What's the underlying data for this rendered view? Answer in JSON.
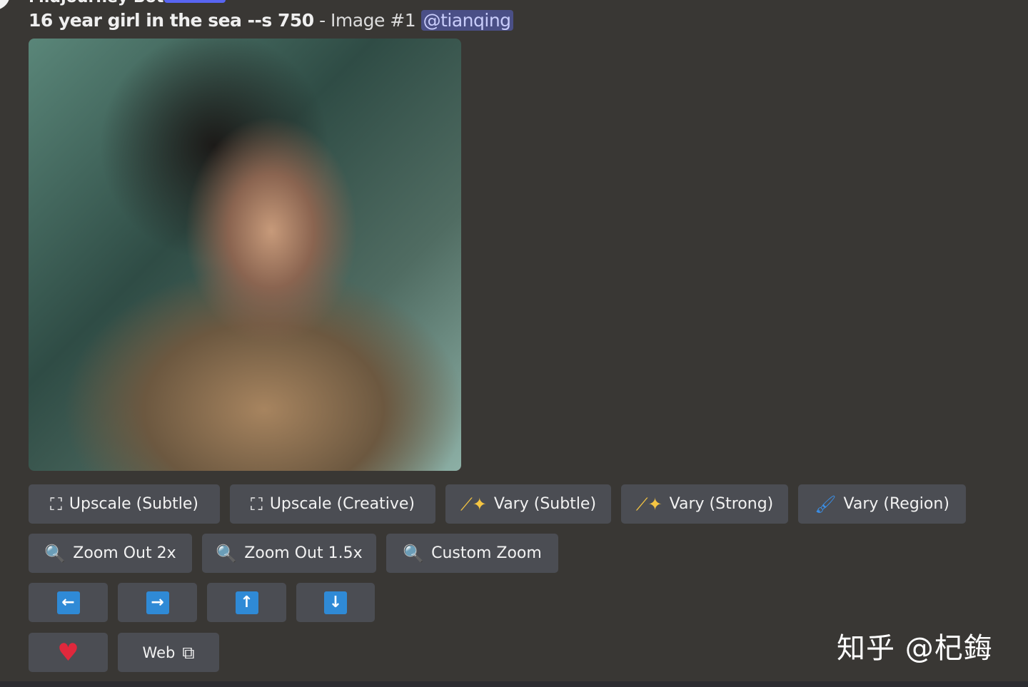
{
  "message": {
    "author": "Midjourney Bot",
    "prompt": "16 year girl in the sea --s 750",
    "separator": " - ",
    "image_label": "Image #1",
    "mention": "@tianqing"
  },
  "buttons_row1": [
    {
      "label": "Upscale (Subtle)",
      "icon": "upscale-icon"
    },
    {
      "label": "Upscale (Creative)",
      "icon": "upscale-icon"
    },
    {
      "label": "Vary (Subtle)",
      "icon": "magic-wand-icon"
    },
    {
      "label": "Vary (Strong)",
      "icon": "magic-wand-icon"
    },
    {
      "label": "Vary (Region)",
      "icon": "paintbrush-icon"
    }
  ],
  "buttons_row2": [
    {
      "label": "Zoom Out 2x",
      "icon": "magnifier-icon"
    },
    {
      "label": "Zoom Out 1.5x",
      "icon": "magnifier-icon"
    },
    {
      "label": "Custom Zoom",
      "icon": "magnifier-icon"
    }
  ],
  "pan_buttons": [
    "arrow-left-icon",
    "arrow-right-icon",
    "arrow-up-icon",
    "arrow-down-icon"
  ],
  "web_label": "Web",
  "watermark": "知乎 @杞鋂",
  "colors": {
    "background": "#393734",
    "button": "#4b4d53",
    "mention_bg": "#4a4f86",
    "arrow_blue": "#2f8ad6",
    "heart": "#e0283c"
  }
}
